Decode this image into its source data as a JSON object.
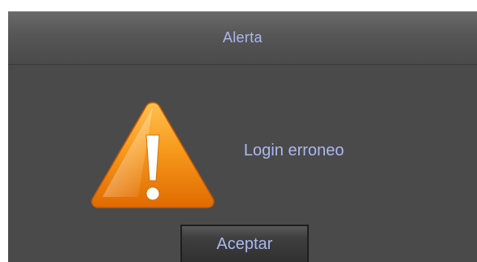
{
  "dialog": {
    "title": "Alerta",
    "message": "Login erroneo",
    "icon": "warning-icon",
    "button_label": "Aceptar"
  },
  "colors": {
    "text": "#aab8f0",
    "background": "#4a4a4a",
    "warning": "#f08a10"
  }
}
